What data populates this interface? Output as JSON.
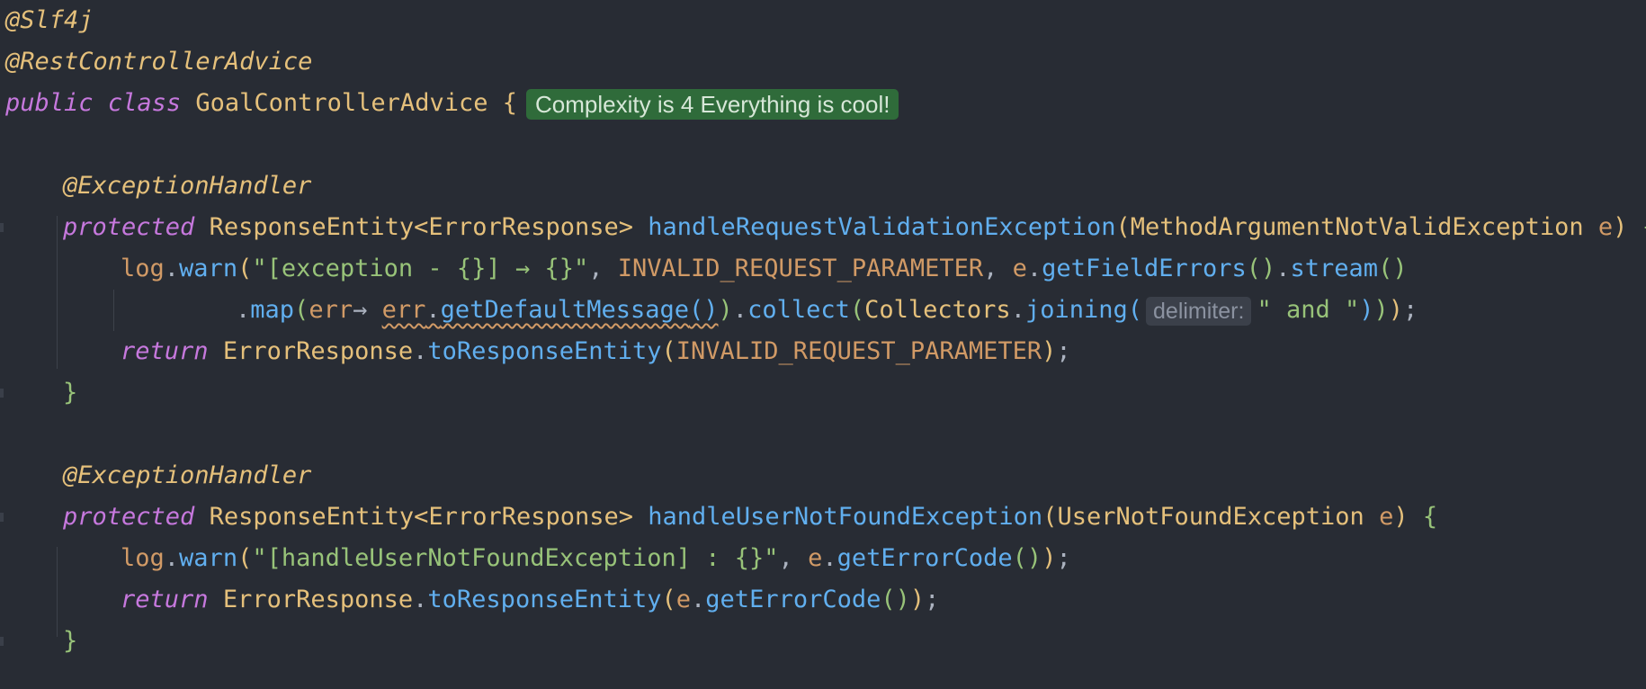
{
  "hints": {
    "complexity": "Complexity is 4 Everything is cool!",
    "delimiter_param": "delimiter:"
  },
  "code": {
    "annotation_slf4j": "@Slf4j",
    "annotation_rest_advice": "@RestControllerAdvice",
    "kw_public": "public",
    "kw_class": "class",
    "class_name": "GoalControllerAdvice",
    "annotation_exception_handler": "@ExceptionHandler",
    "kw_protected": "protected",
    "type_response_entity": "ResponseEntity",
    "type_error_response": "ErrorResponse",
    "method1_name": "handleRequestValidationException",
    "method1_param_type": "MethodArgumentNotValidException",
    "param_e": "e",
    "log": "log",
    "warn": "warn",
    "method1_log_format": "\"[exception - {}] → {}\"",
    "const_invalid_request": "INVALID_REQUEST_PARAMETER",
    "get_field_errors": "getFieldErrors",
    "stream": "stream",
    "map": "map",
    "lambda_param": "err",
    "arrow": "→",
    "get_default_message": "getDefaultMessage",
    "collect": "collect",
    "collectors": "Collectors",
    "joining": "joining",
    "joining_arg": "\" and \"",
    "kw_return": "return",
    "to_response_entity": "toResponseEntity",
    "method2_name": "handleUserNotFoundException",
    "method2_param_type": "UserNotFoundException",
    "method2_log_format": "\"[handleUserNotFoundException] : {}\"",
    "get_error_code": "getErrorCode"
  }
}
